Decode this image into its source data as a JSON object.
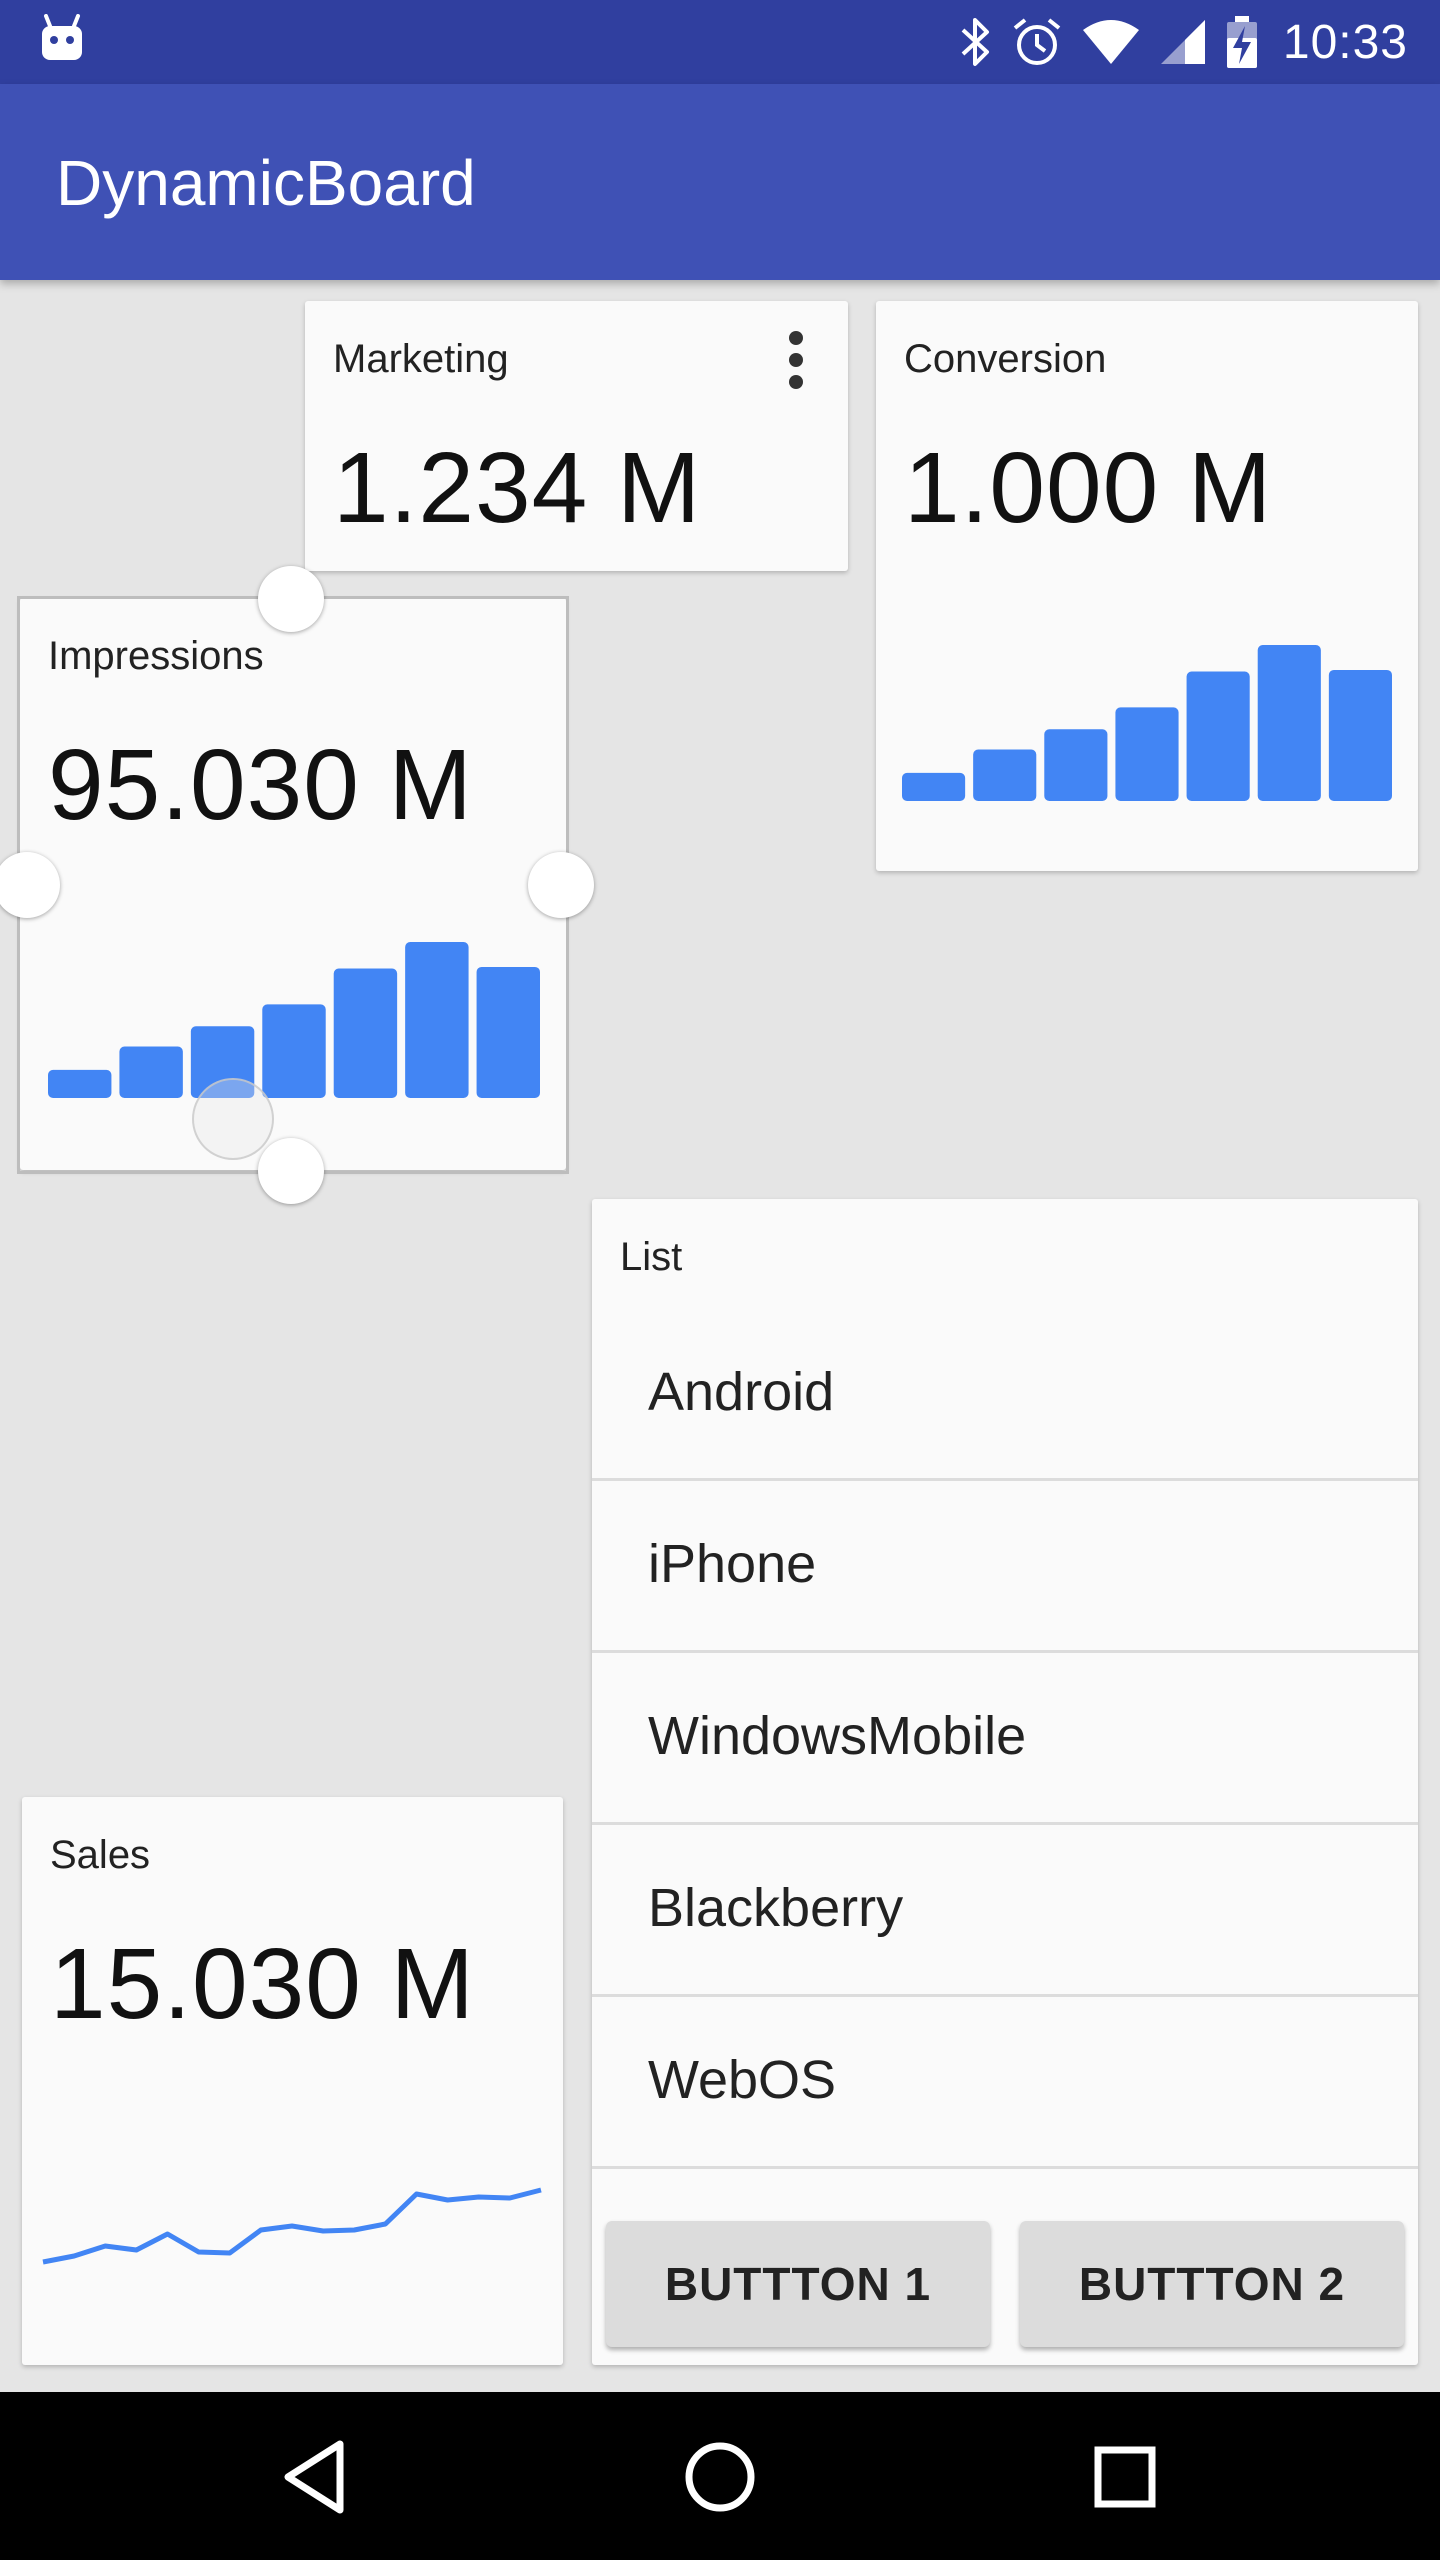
{
  "status_bar": {
    "time": "10:33",
    "icons": [
      "android-notification-icon",
      "bluetooth-icon",
      "alarm-icon",
      "wifi-icon",
      "signal-icon",
      "battery-charging-icon"
    ]
  },
  "app_bar": {
    "title": "DynamicBoard"
  },
  "cards": {
    "marketing": {
      "label": "Marketing",
      "value": "1.234 M",
      "menu_icon": "more-vert-icon"
    },
    "conversion": {
      "label": "Conversion",
      "value": "1.000 M",
      "bars": [
        0.18,
        0.33,
        0.46,
        0.6,
        0.83,
        1.0,
        0.84
      ]
    },
    "impressions": {
      "label": "Impressions",
      "value": "95.030 M",
      "bars": [
        0.18,
        0.33,
        0.46,
        0.6,
        0.83,
        1.0,
        0.84
      ],
      "selected": true
    },
    "sales": {
      "label": "Sales",
      "value": "15.030 M",
      "line": [
        0.1,
        0.16,
        0.26,
        0.22,
        0.38,
        0.2,
        0.19,
        0.42,
        0.46,
        0.41,
        0.42,
        0.48,
        0.78,
        0.72,
        0.75,
        0.74,
        0.82
      ]
    },
    "list": {
      "label": "List",
      "items": [
        "Android",
        "iPhone",
        "WindowsMobile",
        "Blackberry",
        "WebOS"
      ],
      "button1": "BUTTTON 1",
      "button2": "BUTTTON 2"
    }
  },
  "colors": {
    "status_bar": "#303f9f",
    "app_bar": "#3f51b5",
    "chart": "#4285f4",
    "background": "#e5e5e5"
  },
  "nav_bar": {
    "icons": [
      "back-icon",
      "home-icon",
      "recents-icon"
    ]
  }
}
